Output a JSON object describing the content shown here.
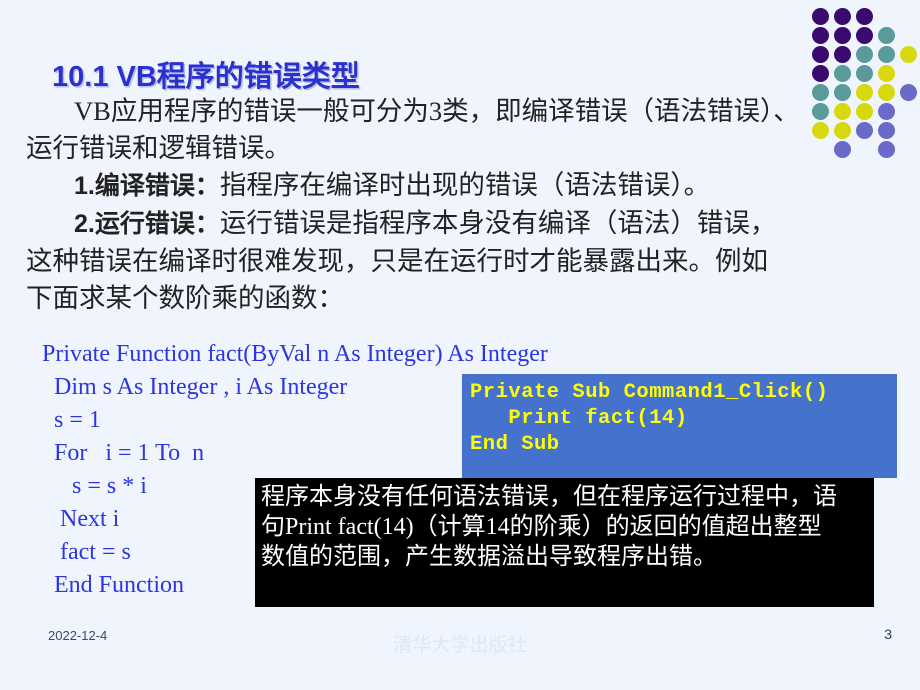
{
  "slide": {
    "background_color": "#eff4fd",
    "title": "10.1 VB程序的错误类型",
    "title_color": "#2b31cf"
  },
  "body": {
    "paragraphs": [
      "VB应用程序的错误一般可分为3类，即编译错误（语法错误）、运行错误和逻辑错误。",
      "1.编译错误：指程序在编译时出现的错误（语法错误）。",
      "2.运行错误：运行错误是指程序本身没有编译（语法）错误，这种错误在编译时很难发现，只是在运行时才能暴露出来。例如下面求某个数阶乘的函数："
    ],
    "lines": {
      "l1": "VB应用程序的错误一般可分为3类，即编译错误（语法错误）、",
      "l2": "运行错误和逻辑错误。",
      "l3_lead": "1.编译错误：",
      "l3_rest": "指程序在编译时出现的错误（语法错误）。",
      "l4_lead": "2.运行错误：",
      "l4_rest": "运行错误是指程序本身没有编译（语法）错误，",
      "l5": "这种错误在编译时很难发现，只是在运行时才能暴露出来。例如",
      "l6": "下面求某个数阶乘的函数："
    }
  },
  "vb_code": {
    "color": "#2b36e0",
    "lines": [
      "Private Function fact(ByVal n As Integer) As Integer",
      "  Dim s As Integer , i As Integer",
      "  s = 1",
      "  For   i = 1 To  n",
      "     s = s * i",
      "   Next i",
      "   fact = s",
      "  End Function"
    ]
  },
  "sub_box": {
    "background_color": "#4472cd",
    "text_color": "#ffff00",
    "lines": [
      "Private Sub Command1_Click()",
      "   Print fact(14)",
      "End Sub"
    ]
  },
  "note_box": {
    "background_color": "#000000",
    "text_color": "#ffffff",
    "lines": [
      "程序本身没有任何语法错误，但在程序运行过程中，语",
      "句Print fact(14)（计算14的阶乘）的返回的值超出整型",
      "数值的范围，产生数据溢出导致程序出错。"
    ]
  },
  "footer": {
    "date": "2022-12-4",
    "publisher": "清华大学出版社",
    "page_number": "3"
  },
  "decoration": {
    "dot_colors": {
      "purple": "#3a0a6e",
      "teal": "#5a9a9a",
      "yellow": "#d8d80e",
      "violet": "#6a6ac8"
    },
    "dots": [
      {
        "c": 0,
        "r": 0,
        "color": "#3a0a6e"
      },
      {
        "c": 1,
        "r": 0,
        "color": "#3a0a6e"
      },
      {
        "c": 2,
        "r": 0,
        "color": "#3a0a6e"
      },
      {
        "c": 0,
        "r": 1,
        "color": "#3a0a6e"
      },
      {
        "c": 1,
        "r": 1,
        "color": "#3a0a6e"
      },
      {
        "c": 2,
        "r": 1,
        "color": "#3a0a6e"
      },
      {
        "c": 3,
        "r": 1,
        "color": "#5a9a9a"
      },
      {
        "c": 0,
        "r": 2,
        "color": "#3a0a6e"
      },
      {
        "c": 1,
        "r": 2,
        "color": "#3a0a6e"
      },
      {
        "c": 2,
        "r": 2,
        "color": "#5a9a9a"
      },
      {
        "c": 3,
        "r": 2,
        "color": "#5a9a9a"
      },
      {
        "c": 4,
        "r": 2,
        "color": "#d8d80e"
      },
      {
        "c": 0,
        "r": 3,
        "color": "#3a0a6e"
      },
      {
        "c": 1,
        "r": 3,
        "color": "#5a9a9a"
      },
      {
        "c": 2,
        "r": 3,
        "color": "#5a9a9a"
      },
      {
        "c": 3,
        "r": 3,
        "color": "#d8d80e"
      },
      {
        "c": 0,
        "r": 4,
        "color": "#5a9a9a"
      },
      {
        "c": 1,
        "r": 4,
        "color": "#5a9a9a"
      },
      {
        "c": 2,
        "r": 4,
        "color": "#d8d80e"
      },
      {
        "c": 3,
        "r": 4,
        "color": "#d8d80e"
      },
      {
        "c": 4,
        "r": 4,
        "color": "#6a6ac8"
      },
      {
        "c": 0,
        "r": 5,
        "color": "#5a9a9a"
      },
      {
        "c": 1,
        "r": 5,
        "color": "#d8d80e"
      },
      {
        "c": 2,
        "r": 5,
        "color": "#d8d80e"
      },
      {
        "c": 3,
        "r": 5,
        "color": "#6a6ac8"
      },
      {
        "c": 0,
        "r": 6,
        "color": "#d8d80e"
      },
      {
        "c": 1,
        "r": 6,
        "color": "#d8d80e"
      },
      {
        "c": 2,
        "r": 6,
        "color": "#6a6ac8"
      },
      {
        "c": 3,
        "r": 6,
        "color": "#6a6ac8"
      },
      {
        "c": 1,
        "r": 7,
        "color": "#6a6ac8"
      },
      {
        "c": 3,
        "r": 7,
        "color": "#6a6ac8"
      }
    ]
  }
}
